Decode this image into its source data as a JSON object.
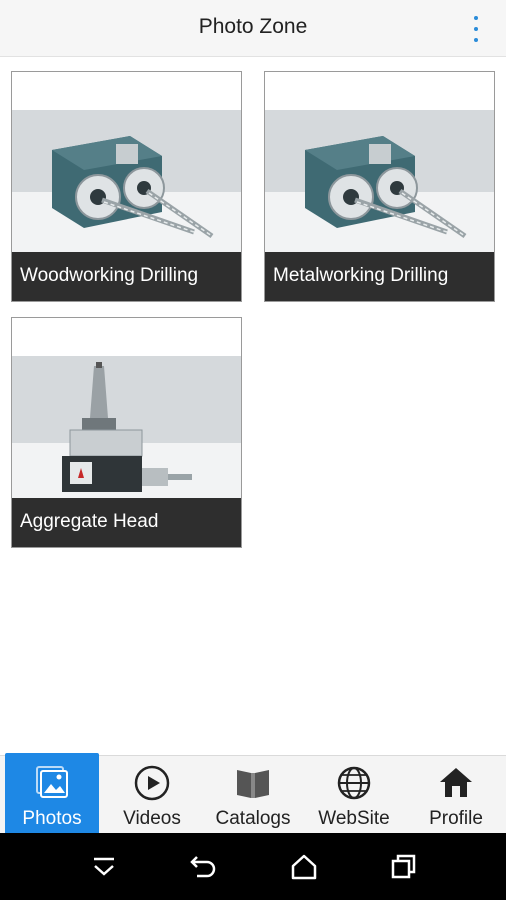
{
  "header": {
    "title": "Photo Zone",
    "menu_icon": "more-vert-icon",
    "menu_color": "#2b8cd9"
  },
  "gallery": {
    "items": [
      {
        "caption": "Woodworking Drilling",
        "image": "double-spindle-drill-head-photo"
      },
      {
        "caption": "Metalworking Drilling",
        "image": "double-spindle-drill-head-photo"
      },
      {
        "caption": "Aggregate Head",
        "image": "aggregate-head-photo"
      }
    ]
  },
  "tabs": [
    {
      "label": "Photos",
      "icon": "photos-icon",
      "active": true
    },
    {
      "label": "Videos",
      "icon": "play-circle-icon",
      "active": false
    },
    {
      "label": "Catalogs",
      "icon": "catalog-book-icon",
      "active": false
    },
    {
      "label": "WebSite",
      "icon": "globe-icon",
      "active": false
    },
    {
      "label": "Profile",
      "icon": "home-icon",
      "active": false
    }
  ],
  "system_nav": {
    "buttons": [
      "keyboard-hide-icon",
      "back-icon",
      "home-icon",
      "recents-icon"
    ]
  },
  "colors": {
    "accent": "#1e88e5",
    "caption_bg": "#2e2e2e",
    "header_bg": "#f6f6f6",
    "tabbar_bg": "#f4f4f4"
  }
}
